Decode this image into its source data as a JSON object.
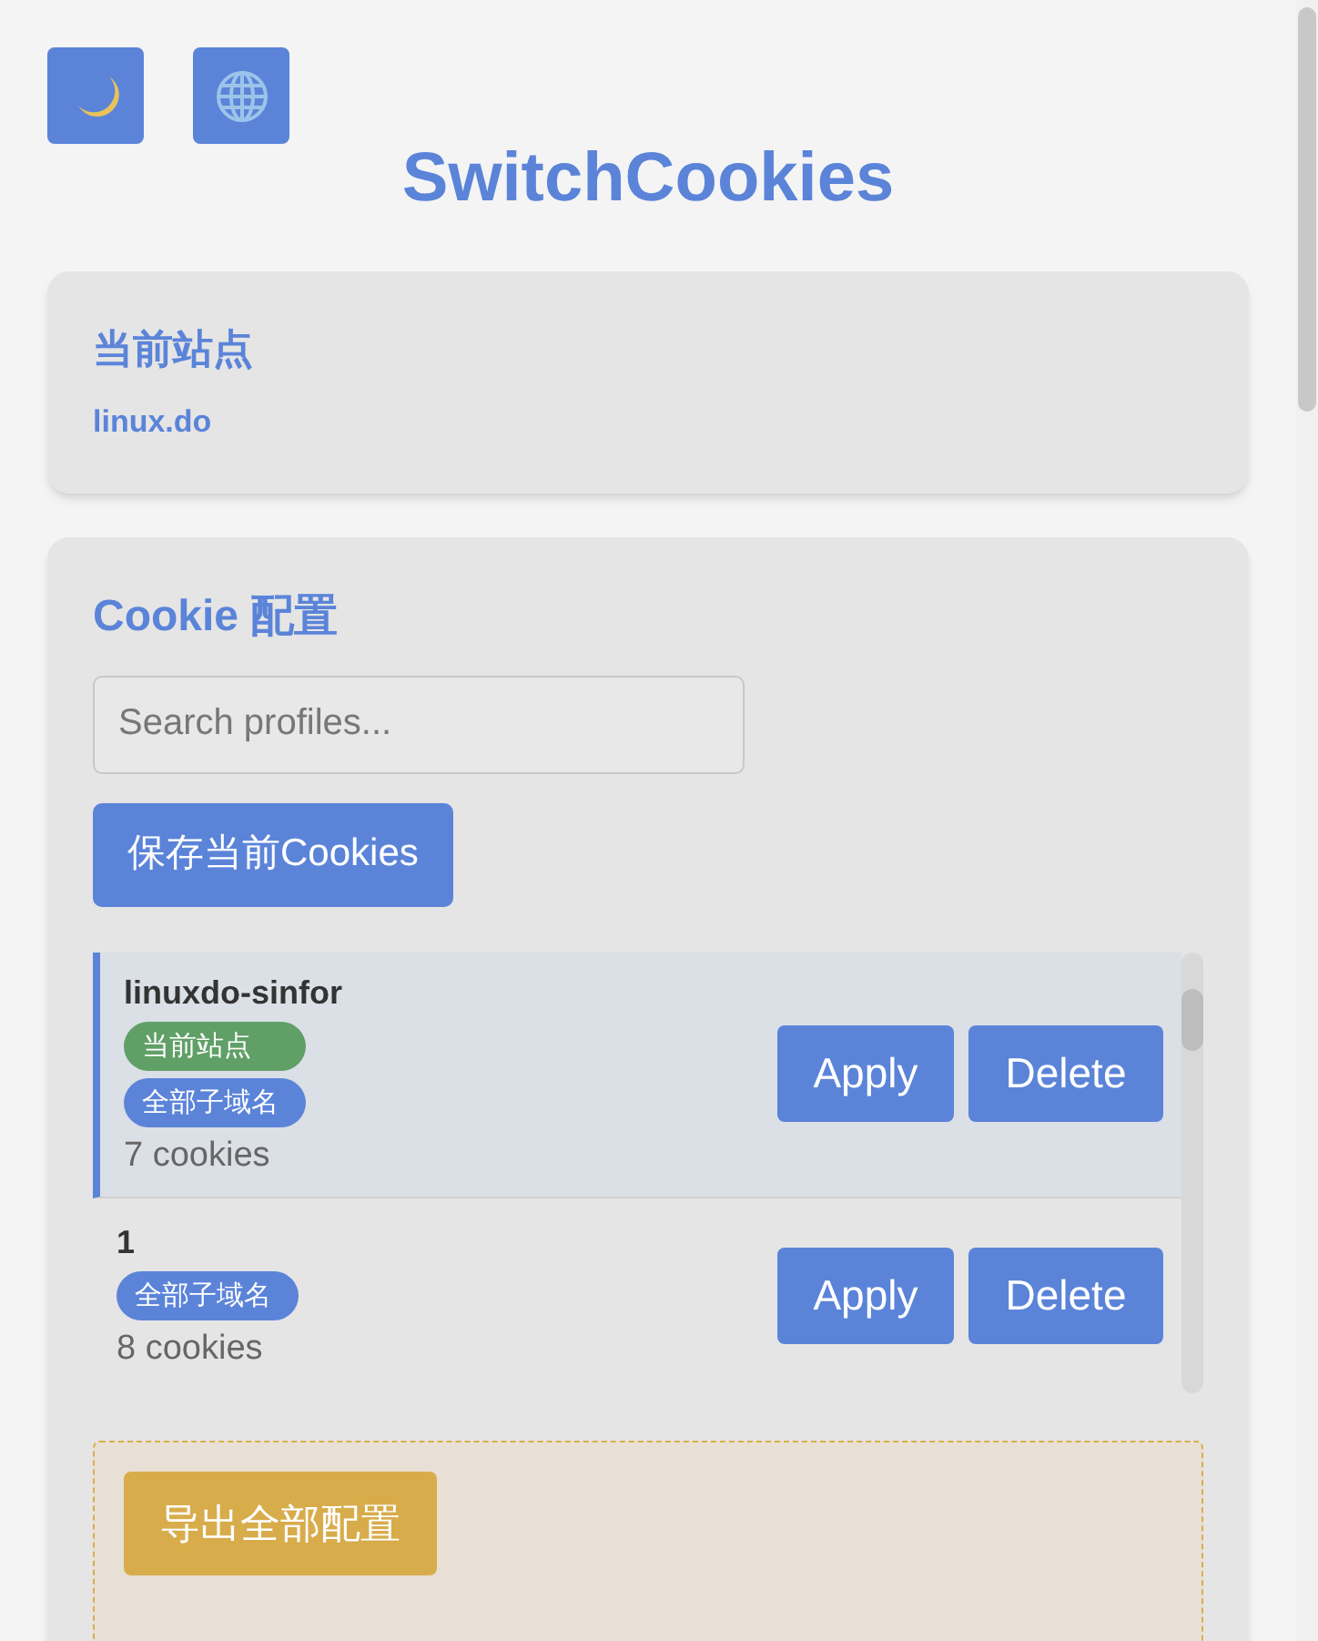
{
  "toolbar": [
    {
      "kind": "theme"
    },
    {
      "kind": "language"
    }
  ],
  "title": "SwitchCookies",
  "current_site": {
    "heading": "当前站点",
    "domain": "linux.do"
  },
  "profiles_panel": {
    "heading": "Cookie 配置",
    "search": {
      "placeholder": "Search profiles..."
    },
    "save_button": "保存当前Cookies",
    "profiles": [
      {
        "name": "linuxdo-sinfor",
        "selected": true,
        "tags": [
          {
            "label": "当前站点",
            "color": "#60a066"
          },
          {
            "label": "全部子域名",
            "color": "#5b84d9"
          }
        ],
        "count": "7 cookies",
        "apply": "Apply",
        "delete": "Delete"
      },
      {
        "name": "1",
        "selected": false,
        "tags": [
          {
            "label": "全部子域名",
            "color": "#5b84d9"
          }
        ],
        "count": "8 cookies",
        "apply": "Apply",
        "delete": "Delete"
      }
    ]
  },
  "export_button": "导出全部配置"
}
